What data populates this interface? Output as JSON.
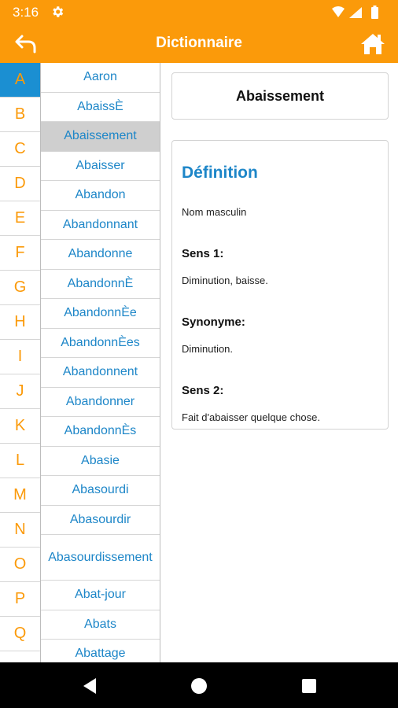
{
  "status": {
    "time": "3:16"
  },
  "app_bar": {
    "title": "Dictionnaire"
  },
  "letters": [
    "A",
    "B",
    "C",
    "D",
    "E",
    "F",
    "G",
    "H",
    "I",
    "J",
    "K",
    "L",
    "M",
    "N",
    "O",
    "P",
    "Q"
  ],
  "words": [
    "Aaron",
    "AbaissÈ",
    "Abaissement",
    "Abaisser",
    "Abandon",
    "Abandonnant",
    "Abandonne",
    "AbandonnÈ",
    "AbandonnÈe",
    "AbandonnÈes",
    "Abandonnent",
    "Abandonner",
    "AbandonnÈs",
    "Abasie",
    "Abasourdi",
    "Abasourdir",
    "Abasourdissement",
    "Abat-jour",
    "Abats",
    "Abattage"
  ],
  "selected_word": "Abaissement",
  "definition": {
    "title": "Définition",
    "type": "Nom masculin",
    "sense1_label": "Sens 1:",
    "sense1_text": "Diminution, baisse.",
    "synonym_label": "Synonyme:",
    "synonym_text": "Diminution.",
    "sense2_label": "Sens 2:",
    "sense2_text": "Fait d'abaisser quelque chose."
  },
  "colors": {
    "accent": "#fb9a0a",
    "link": "#1d86c8",
    "active_letter_bg": "#1b8fd2",
    "active_word_bg": "#cfcfcf"
  }
}
